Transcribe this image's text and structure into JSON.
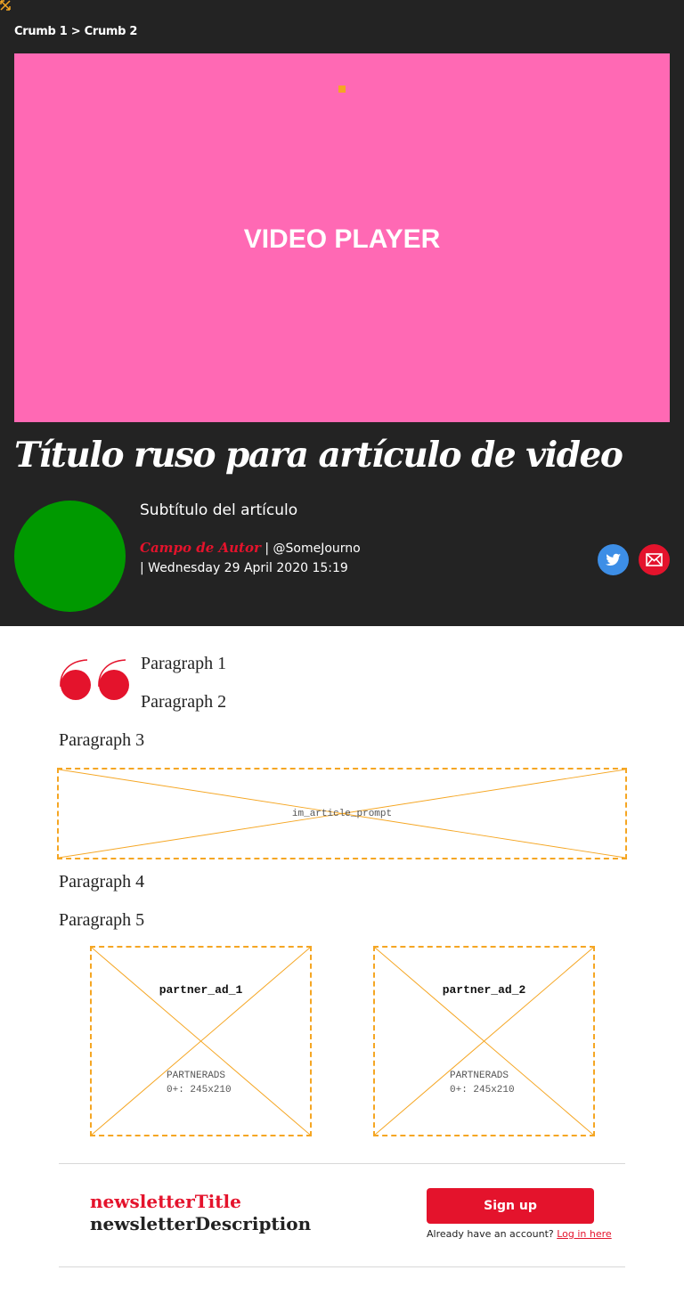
{
  "breadcrumb": {
    "crumb1": "Crumb 1",
    "separator": ">",
    "crumb2": "Crumb 2"
  },
  "video": {
    "label": "VIDEO PLAYER",
    "background": "#ff69b4"
  },
  "article": {
    "title": "Título ruso para artículo de video",
    "subtitle": "Subtítulo del artículo",
    "author": "Campo de Autor",
    "separator": "|",
    "handle": "@SomeJourno",
    "date": "Wednesday 29 April 2020 15:19"
  },
  "share": {
    "icons": [
      "twitter-icon",
      "email-icon"
    ]
  },
  "body": {
    "paragraphs": [
      "Paragraph 1",
      "Paragraph 2",
      "Paragraph 3",
      "Paragraph 4",
      "Paragraph 5"
    ]
  },
  "ads": {
    "prompt": "im_article_prompt",
    "partner_ads": [
      {
        "name": "partner_ad_1",
        "type": "PARTNERADS",
        "size": "0+: 245x210"
      },
      {
        "name": "partner_ad_2",
        "type": "PARTNERADS",
        "size": "0+: 245x210"
      }
    ]
  },
  "newsletter": {
    "title": "newsletterTitle",
    "description": "newsletterDescription",
    "signup_label": "Sign up",
    "account_text": "Already have an account?",
    "login_label": "Log in here"
  },
  "colors": {
    "header_bg": "#232323",
    "accent": "#e4132c",
    "avatar": "#009900",
    "ad_outline": "#f5a623",
    "twitter": "#3d8ee6"
  }
}
